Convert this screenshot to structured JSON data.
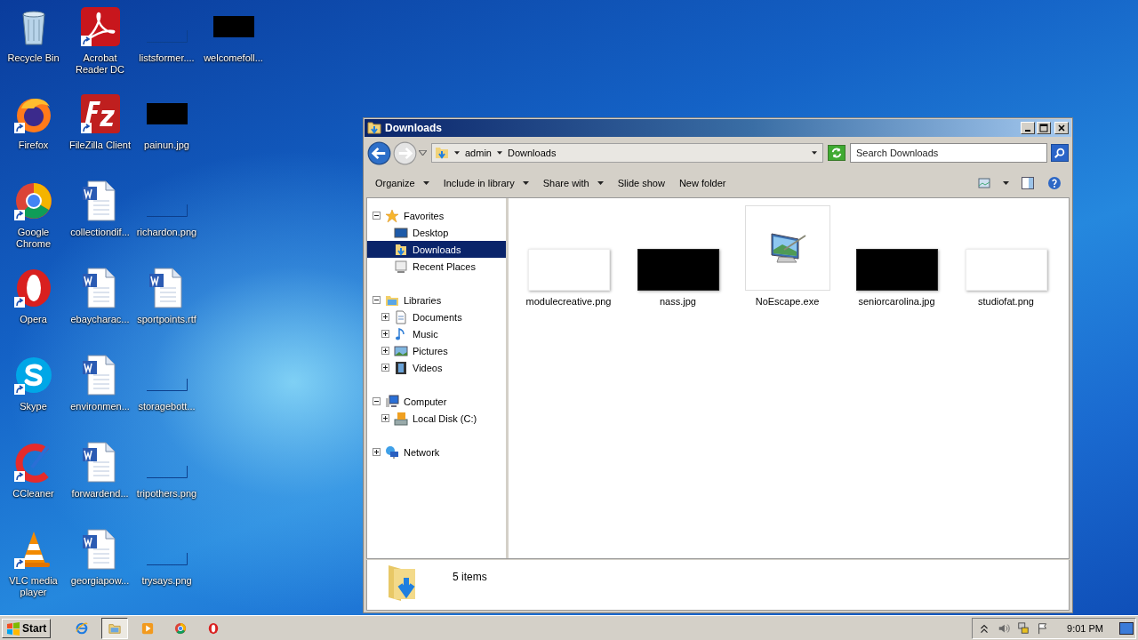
{
  "desktop": {
    "columns": [
      [
        {
          "label": "Recycle Bin",
          "kind": "recycle"
        },
        {
          "label": "Firefox",
          "kind": "firefox"
        },
        {
          "label": "Google Chrome",
          "kind": "chrome"
        },
        {
          "label": "Opera",
          "kind": "opera"
        },
        {
          "label": "Skype",
          "kind": "skype"
        },
        {
          "label": "CCleaner",
          "kind": "ccleaner"
        },
        {
          "label": "VLC media player",
          "kind": "vlc"
        }
      ],
      [
        {
          "label": "Acrobat Reader DC",
          "kind": "acrobat"
        },
        {
          "label": "FileZilla Client",
          "kind": "filezilla"
        },
        {
          "label": "collectiondif...",
          "kind": "word"
        },
        {
          "label": "ebaycharac...",
          "kind": "word"
        },
        {
          "label": "environmen...",
          "kind": "word"
        },
        {
          "label": "forwardend...",
          "kind": "word"
        },
        {
          "label": "georgiapow...",
          "kind": "word"
        }
      ],
      [
        {
          "label": "listsformer....",
          "kind": "image-blank"
        },
        {
          "label": "painun.jpg",
          "kind": "image-dark"
        },
        {
          "label": "richardon.png",
          "kind": "image-blank"
        },
        {
          "label": "sportpoints.rtf",
          "kind": "word"
        },
        {
          "label": "storagebott...",
          "kind": "image-blank"
        },
        {
          "label": "tripothers.png",
          "kind": "image-blank"
        },
        {
          "label": "trysays.png",
          "kind": "image-blank"
        }
      ],
      [
        {
          "label": "welcomefoll...",
          "kind": "image-dark"
        }
      ]
    ]
  },
  "window": {
    "title": "Downloads",
    "address": {
      "segments": [
        "admin",
        "Downloads"
      ]
    },
    "search": {
      "placeholder": "Search Downloads"
    },
    "toolbar": [
      {
        "label": "Organize",
        "dropdown": true
      },
      {
        "label": "Include in library",
        "dropdown": true
      },
      {
        "label": "Share with",
        "dropdown": true
      },
      {
        "label": "Slide show",
        "dropdown": false
      },
      {
        "label": "New folder",
        "dropdown": false
      }
    ],
    "nav": [
      {
        "label": "Favorites",
        "kind": "star",
        "expanded": true,
        "selected": false,
        "children": [
          {
            "label": "Desktop",
            "kind": "desktop",
            "selected": false
          },
          {
            "label": "Downloads",
            "kind": "downloads",
            "selected": true
          },
          {
            "label": "Recent Places",
            "kind": "recent",
            "selected": false
          }
        ]
      },
      {
        "label": "Libraries",
        "kind": "library",
        "expanded": true,
        "selected": false,
        "children": [
          {
            "label": "Documents",
            "kind": "documents",
            "expanded": false,
            "selected": false
          },
          {
            "label": "Music",
            "kind": "music",
            "expanded": false,
            "selected": false
          },
          {
            "label": "Pictures",
            "kind": "pictures",
            "expanded": false,
            "selected": false
          },
          {
            "label": "Videos",
            "kind": "videos",
            "expanded": false,
            "selected": false
          }
        ]
      },
      {
        "label": "Computer",
        "kind": "computer",
        "expanded": true,
        "selected": false,
        "children": [
          {
            "label": "Local Disk (C:)",
            "kind": "disk",
            "expanded": false,
            "selected": false
          }
        ]
      },
      {
        "label": "Network",
        "kind": "network",
        "expanded": false,
        "selected": false
      }
    ],
    "files": [
      {
        "name": "modulecreative.png",
        "kind": "image-light"
      },
      {
        "name": "nass.jpg",
        "kind": "image-dark"
      },
      {
        "name": "NoEscape.exe",
        "kind": "program"
      },
      {
        "name": "seniorcarolina.jpg",
        "kind": "image-dark"
      },
      {
        "name": "studiofat.png",
        "kind": "image-light"
      }
    ],
    "status": "5 items"
  },
  "taskbar": {
    "start": "Start",
    "apps": [
      {
        "kind": "ie",
        "selected": false
      },
      {
        "kind": "explorer",
        "selected": true
      },
      {
        "kind": "media",
        "selected": false
      },
      {
        "kind": "chrome",
        "selected": false
      },
      {
        "kind": "opera",
        "selected": false
      }
    ],
    "clock": "9:01 PM"
  }
}
